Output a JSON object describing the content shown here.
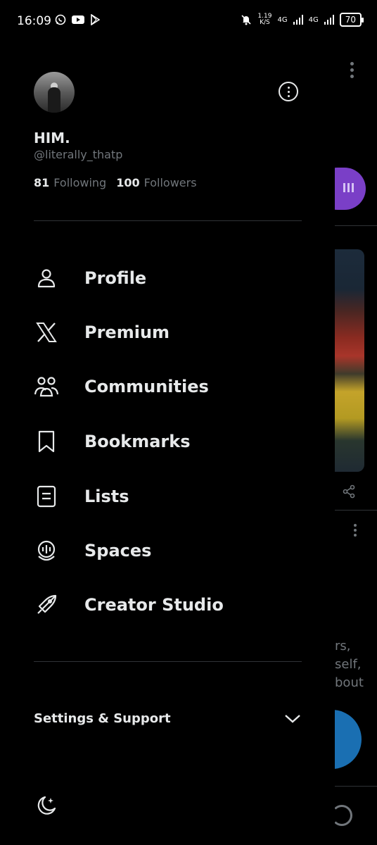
{
  "status_bar": {
    "time": "16:09",
    "net_speed_value": "1.19",
    "net_speed_unit": "K/S",
    "signal1": "4G",
    "signal2": "4G",
    "battery": "70"
  },
  "drawer": {
    "display_name": "HIM.",
    "handle": "@literally_thatp",
    "following_count": "81",
    "following_label": "Following",
    "followers_count": "100",
    "followers_label": "Followers",
    "menu": [
      {
        "label": "Profile",
        "icon": "person-icon"
      },
      {
        "label": "Premium",
        "icon": "x-logo-icon"
      },
      {
        "label": "Communities",
        "icon": "communities-icon"
      },
      {
        "label": "Bookmarks",
        "icon": "bookmark-icon"
      },
      {
        "label": "Lists",
        "icon": "list-icon"
      },
      {
        "label": "Spaces",
        "icon": "spaces-icon"
      },
      {
        "label": "Creator Studio",
        "icon": "rocket-icon"
      }
    ],
    "settings_label": "Settings & Support"
  },
  "background_feed": {
    "text_lines": [
      "rs,",
      "self,",
      "bout"
    ]
  }
}
